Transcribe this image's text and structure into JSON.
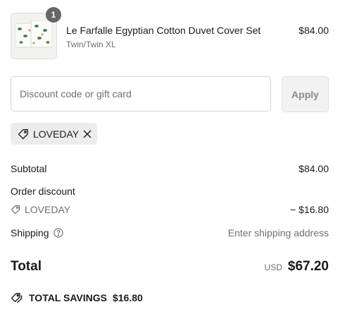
{
  "product": {
    "quantity": "1",
    "title": "Le Farfalle Egyptian Cotton Duvet Cover Set",
    "variant": "Twin/Twin XL",
    "price": "$84.00"
  },
  "discount": {
    "placeholder": "Discount code or gift card",
    "value": "",
    "apply_label": "Apply",
    "applied_code": "LOVEDAY"
  },
  "summary": {
    "subtotal_label": "Subtotal",
    "subtotal_value": "$84.00",
    "order_discount_label": "Order discount",
    "discount_code": "LOVEDAY",
    "discount_value": "− $16.80",
    "shipping_label": "Shipping",
    "shipping_value": "Enter shipping address",
    "total_label": "Total",
    "currency": "USD",
    "total_value": "$67.20",
    "savings_label": "TOTAL SAVINGS",
    "savings_value": "$16.80"
  },
  "icons": {
    "tag": "tag-icon",
    "close": "close-icon",
    "help": "help-circle-icon",
    "savings": "double-tag-icon"
  },
  "colors": {
    "muted_text": "#707070",
    "chip_bg": "#ececec",
    "badge_bg": "#666666"
  }
}
